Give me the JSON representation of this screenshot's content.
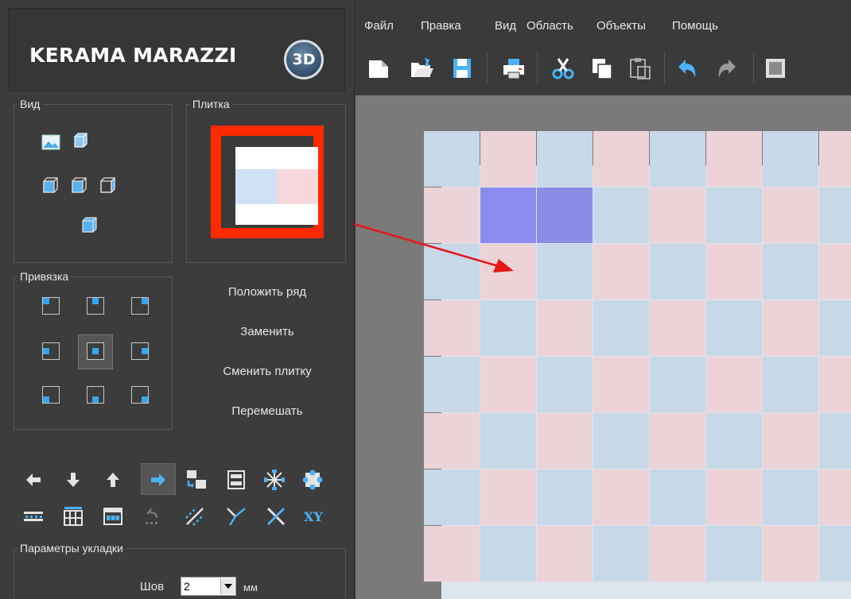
{
  "logo": {
    "text": "KERAMA MARAZZI",
    "badge": "3D"
  },
  "groups": {
    "view": "Вид",
    "tile": "Плитка",
    "anchor": "Привязка",
    "params": "Параметры укладки"
  },
  "actions": {
    "lay_row": "Положить ряд",
    "replace": "Заменить",
    "change_tile": "Сменить плитку",
    "shuffle": "Перемешать"
  },
  "params": {
    "seam_label": "Шов",
    "seam_value": "2",
    "unit": "мм"
  },
  "menu": [
    "Файл",
    "Правка",
    "Вид",
    "Область",
    "Объекты",
    "Помощь"
  ],
  "colors": {
    "accent": "#35a6ee",
    "highlight": "#ff2a00",
    "selected_tile": "#8b8cf0",
    "tile_blue": "#c7d8e8",
    "tile_pink": "#ecd3d7"
  },
  "toolbar_icons": [
    "new-file-icon",
    "open-folder-icon",
    "save-icon",
    "print-icon",
    "cut-icon",
    "copy-icon",
    "paste-icon",
    "undo-icon",
    "redo-icon",
    "frame-icon"
  ],
  "tools_row1": [
    "arrow-left-icon",
    "arrow-down-icon",
    "arrow-up-icon",
    "arrow-right-icon",
    "swap-icon",
    "rows-icon",
    "snowflake-icon",
    "puzzle-icon"
  ],
  "tools_row2": [
    "spacing-h-icon",
    "spacing-grid-icon",
    "calendar-grid-icon",
    "undo-dots-icon",
    "diagonal-icon",
    "y-split-icon",
    "cross-icon",
    "xy-icon"
  ],
  "xy_text": "XY"
}
